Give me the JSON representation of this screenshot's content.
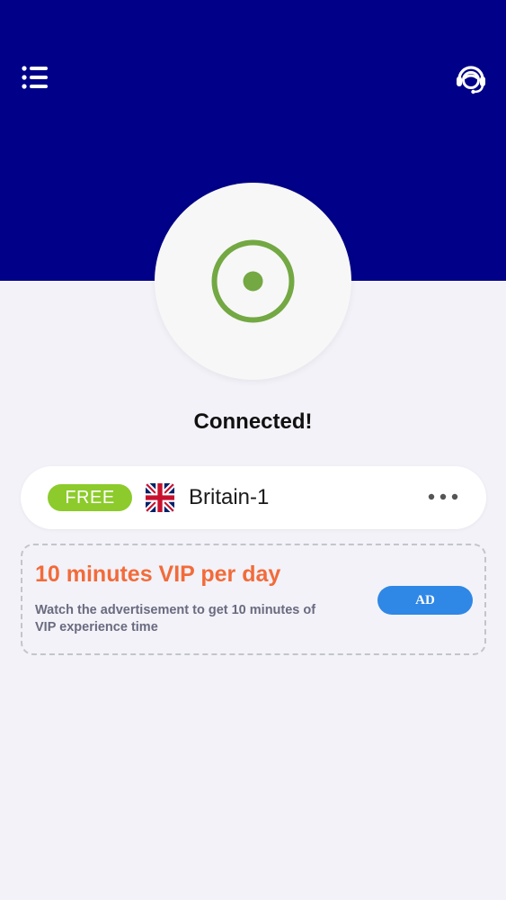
{
  "colors": {
    "header": "#000088",
    "background": "#f2f2f8",
    "connected_green": "#73a843",
    "free_badge": "#8ccb2b",
    "vip_title": "#f26b3a",
    "ad_button": "#2f87e6"
  },
  "header": {
    "menu_icon": "list-menu-icon",
    "support_icon": "headset-support-icon"
  },
  "connect": {
    "state_icon": "connected-ring-icon",
    "status": "Connected!"
  },
  "server": {
    "tier_badge": "FREE",
    "flag_icon": "uk-flag-icon",
    "name": "Britain-1",
    "more_icon": "more-dots-icon"
  },
  "vip_promo": {
    "title": "10 minutes VIP per day",
    "description": "Watch the advertisement to get 10 minutes of VIP experience time",
    "button_label": "AD"
  }
}
